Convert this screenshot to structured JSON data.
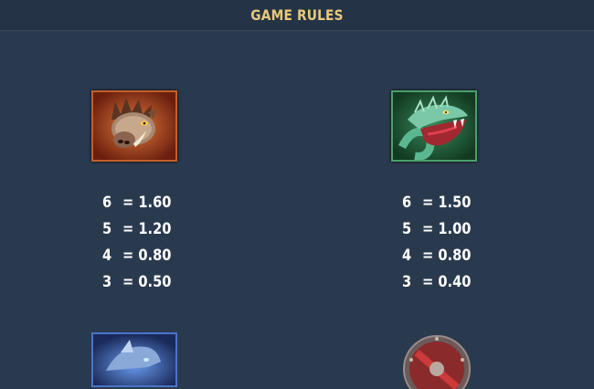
{
  "header": {
    "title": "GAME RULES"
  },
  "symbols": [
    {
      "icon": "boar-icon",
      "border_color": "#c2602a",
      "payouts": [
        {
          "count": "6",
          "value": "= 1.60"
        },
        {
          "count": "5",
          "value": "= 1.20"
        },
        {
          "count": "4",
          "value": "= 0.80"
        },
        {
          "count": "3",
          "value": "= 0.50"
        }
      ]
    },
    {
      "icon": "snake-icon",
      "border_color": "#4aa06a",
      "payouts": [
        {
          "count": "6",
          "value": "= 1.50"
        },
        {
          "count": "5",
          "value": "= 1.00"
        },
        {
          "count": "4",
          "value": "= 0.80"
        },
        {
          "count": "3",
          "value": "= 0.40"
        }
      ]
    },
    {
      "icon": "wolf-icon",
      "border_color": "#4a74c8"
    },
    {
      "icon": "shield-icon"
    }
  ],
  "colors": {
    "background": "#2a3a4e",
    "title": "#e8c87a",
    "text": "#ffffff"
  }
}
